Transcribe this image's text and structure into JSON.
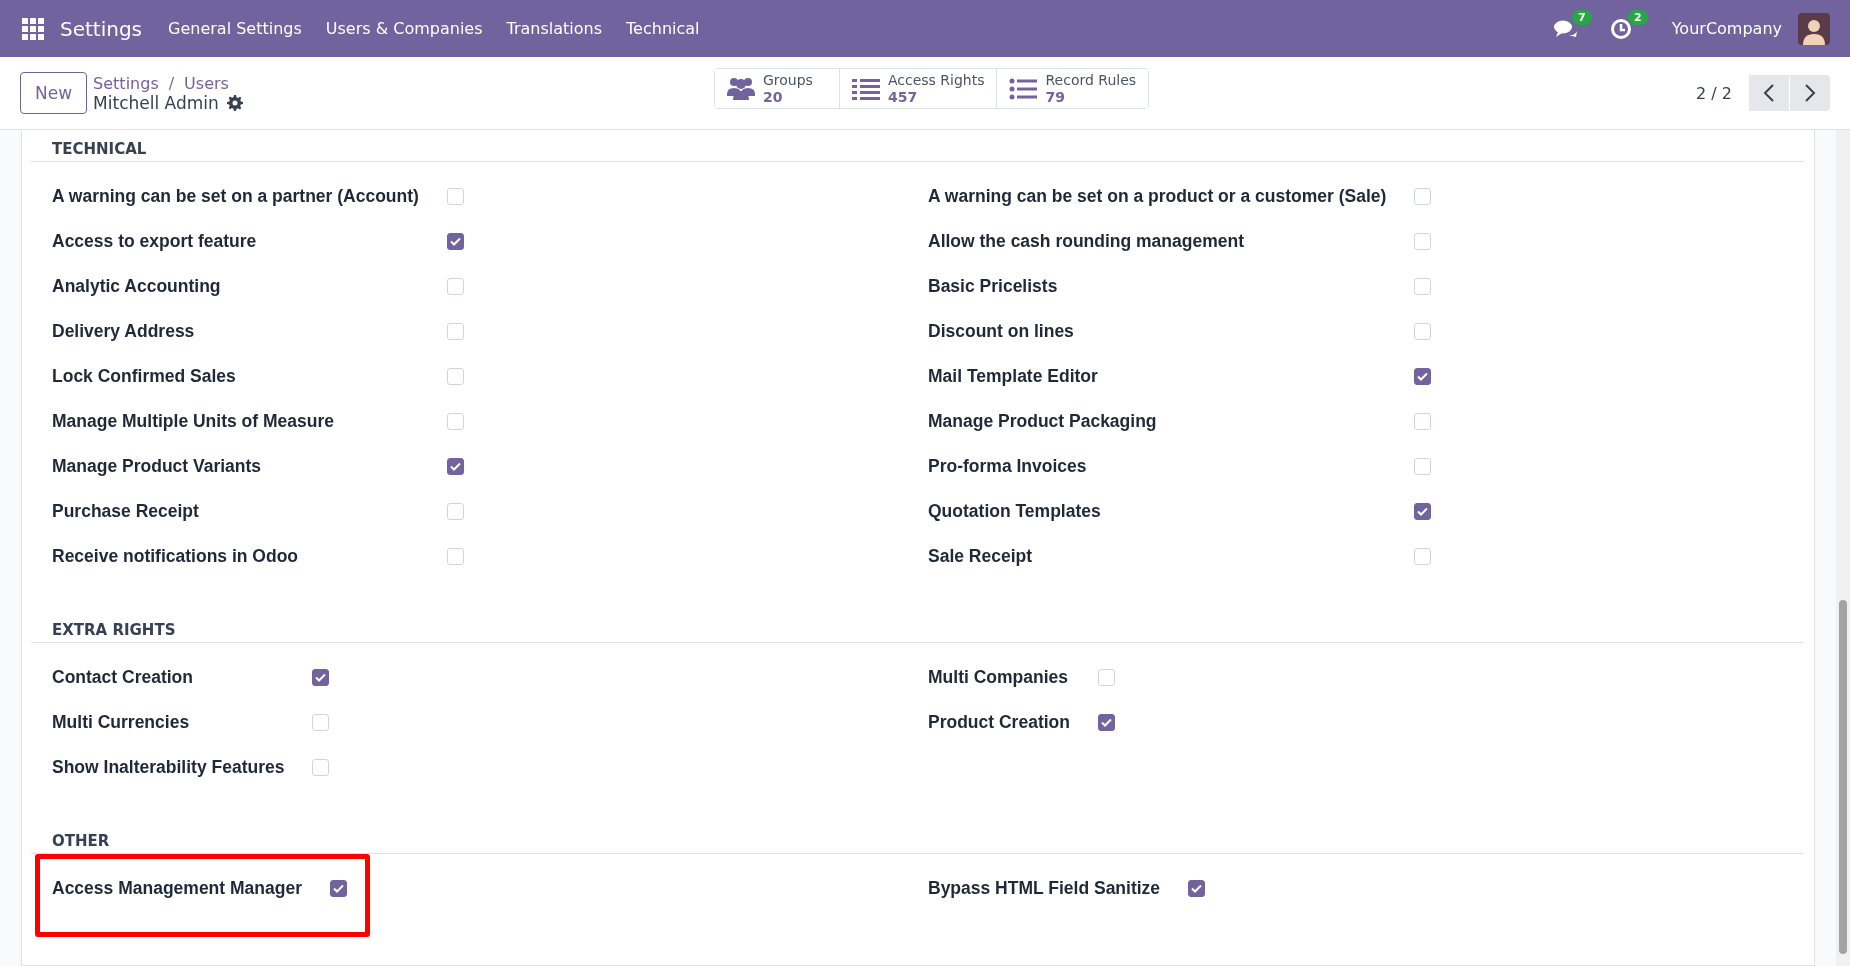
{
  "topbar": {
    "app_name": "Settings",
    "menu": [
      "General Settings",
      "Users & Companies",
      "Translations",
      "Technical"
    ],
    "messages_badge": "7",
    "activities_badge": "2",
    "company": "YourCompany"
  },
  "control_panel": {
    "new_button": "New",
    "breadcrumb": [
      "Settings",
      "Users"
    ],
    "breadcrumb_separator": "/",
    "record_title": "Mitchell Admin",
    "pager": "2 / 2",
    "stat_buttons": [
      {
        "kind": "people",
        "label": "Groups",
        "value": "20"
      },
      {
        "kind": "lines",
        "label": "Access Rights",
        "value": "457"
      },
      {
        "kind": "bullets",
        "label": "Record Rules",
        "value": "79"
      }
    ]
  },
  "sections": [
    {
      "title": "TECHNICAL",
      "left": [
        {
          "label": "A warning can be set on a partner (Account)",
          "checked": false
        },
        {
          "label": "Access to export feature",
          "checked": true
        },
        {
          "label": "Analytic Accounting",
          "checked": false
        },
        {
          "label": "Delivery Address",
          "checked": false
        },
        {
          "label": "Lock Confirmed Sales",
          "checked": false
        },
        {
          "label": "Manage Multiple Units of Measure",
          "checked": false
        },
        {
          "label": "Manage Product Variants",
          "checked": true
        },
        {
          "label": "Purchase Receipt",
          "checked": false
        },
        {
          "label": "Receive notifications in Odoo",
          "checked": false
        }
      ],
      "right": [
        {
          "label": "A warning can be set on a product or a customer (Sale)",
          "checked": false
        },
        {
          "label": "Allow the cash rounding management",
          "checked": false
        },
        {
          "label": "Basic Pricelists",
          "checked": false
        },
        {
          "label": "Discount on lines",
          "checked": false
        },
        {
          "label": "Mail Template Editor",
          "checked": true
        },
        {
          "label": "Manage Product Packaging",
          "checked": false
        },
        {
          "label": "Pro-forma Invoices",
          "checked": false
        },
        {
          "label": "Quotation Templates",
          "checked": true
        },
        {
          "label": "Sale Receipt",
          "checked": false
        }
      ]
    },
    {
      "title": "EXTRA RIGHTS",
      "left": [
        {
          "label": "Contact Creation",
          "checked": true
        },
        {
          "label": "Multi Currencies",
          "checked": false
        },
        {
          "label": "Show Inalterability Features",
          "checked": false
        }
      ],
      "right": [
        {
          "label": "Multi Companies",
          "checked": false
        },
        {
          "label": "Product Creation",
          "checked": true
        }
      ]
    },
    {
      "title": "OTHER",
      "left": [
        {
          "label": "Access Management Manager",
          "checked": true,
          "highlighted": true
        }
      ],
      "right": [
        {
          "label": "Bypass HTML Field Sanitize",
          "checked": true,
          "highlighted": false
        }
      ]
    }
  ]
}
